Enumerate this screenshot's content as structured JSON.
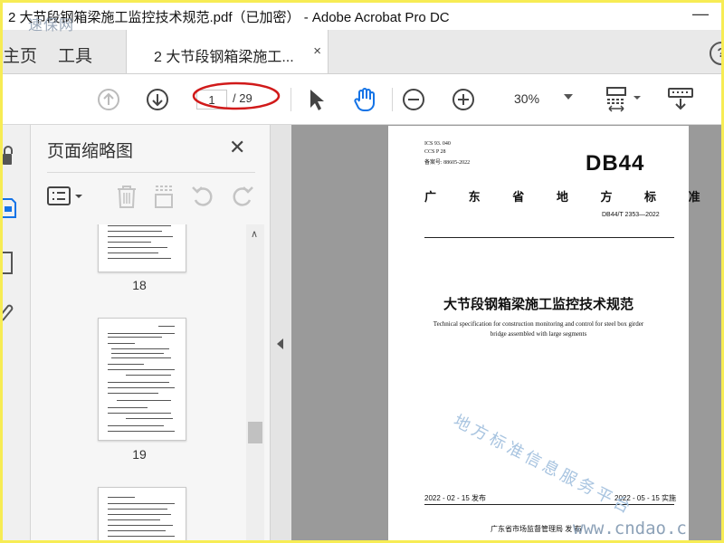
{
  "window": {
    "title": "2 大节段钢箱梁施工监控技术规范.pdf（已加密） - Adobe Acrobat Pro DC",
    "minimize": "—"
  },
  "watermarks": {
    "top_left": "速保网",
    "diagonal": "地方标准信息服务平台",
    "bottom_right": "www.cndao.c"
  },
  "tabs": {
    "home": "主页",
    "tools": "工具",
    "document": "2 大节段钢箱梁施工...",
    "close": "×"
  },
  "help": "?",
  "toolbar": {
    "page_current": "1",
    "page_total": "/ 29",
    "zoom": "30%"
  },
  "panel": {
    "title": "页面缩略图",
    "close": "✕",
    "thumbnails": [
      {
        "number": "18"
      },
      {
        "number": "19"
      }
    ],
    "scroll_up": "∧"
  },
  "document_page": {
    "ics": "ICS   93. 040",
    "ccs": "CCS  P 28",
    "filing": "备案号: 88605-2022",
    "standard_logo": "DB44",
    "region": "广 东 省 地 方 标 准",
    "code": "DB44/T 2353—2022",
    "title_cn": "大节段钢箱梁施工监控技术规范",
    "title_en_line1": "Technical specification for construction monitoring and control for steel box girder",
    "title_en_line2": "bridge assembled with large segments",
    "issue_date": "2022 - 02 - 15 发布",
    "impl_date": "2022 - 05 - 15 实施",
    "issuer": "广东省市场监督管理局    发 布"
  },
  "colors": {
    "accent_yellow": "#f7ec54",
    "annotation_red": "#d11a1a",
    "viewer_bg": "#9a9a9a",
    "icon_gray": "#555555",
    "icon_blue": "#1473e6"
  }
}
